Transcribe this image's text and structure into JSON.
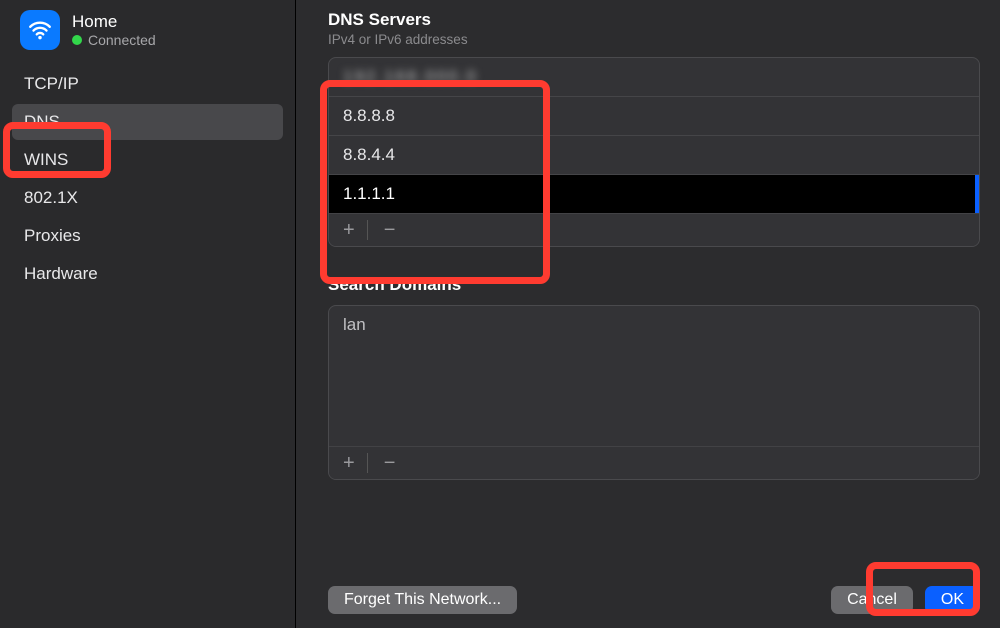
{
  "network": {
    "name": "Home",
    "status": "Connected"
  },
  "sidebar": {
    "items": [
      {
        "label": "TCP/IP"
      },
      {
        "label": "DNS"
      },
      {
        "label": "WINS"
      },
      {
        "label": "802.1X"
      },
      {
        "label": "Proxies"
      },
      {
        "label": "Hardware"
      }
    ],
    "activeIndex": 1
  },
  "dns": {
    "title": "DNS Servers",
    "subtitle": "IPv4 or IPv6 addresses",
    "servers": [
      {
        "value": "192.168.000.0",
        "obscured": true
      },
      {
        "value": "8.8.8.8"
      },
      {
        "value": "8.8.4.4"
      },
      {
        "value": "1.1.1.1",
        "editing": true
      }
    ],
    "add_label": "+",
    "remove_label": "−"
  },
  "search_domains": {
    "title": "Search Domains",
    "items": [
      {
        "value": "lan"
      }
    ],
    "add_label": "+",
    "remove_label": "−"
  },
  "footer": {
    "forget": "Forget This Network...",
    "cancel": "Cancel",
    "ok": "OK"
  }
}
